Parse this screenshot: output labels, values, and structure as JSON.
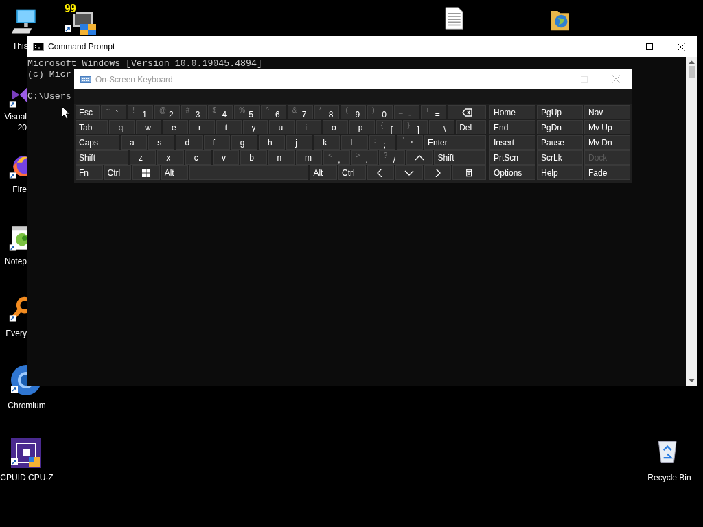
{
  "desktop_icons": [
    {
      "kind": "computer",
      "lines": [
        "This"
      ]
    },
    {
      "kind": "monitor-shield",
      "badge": "99"
    },
    {
      "kind": "document"
    },
    {
      "kind": "folder-globe"
    },
    {
      "kind": "visual-studio",
      "lines": [
        "Visual",
        "20"
      ]
    },
    {
      "kind": "firefox",
      "lines": [
        "Fire"
      ]
    },
    {
      "kind": "notepad",
      "lines": [
        "Notep"
      ]
    },
    {
      "kind": "everything",
      "lines": [
        "Every"
      ]
    },
    {
      "kind": "chromium",
      "lines": [
        "Chromium"
      ]
    },
    {
      "kind": "cpu",
      "lines": [
        "CPUID CPU-Z"
      ]
    },
    {
      "kind": "recycle",
      "lines": [
        "Recycle Bin"
      ]
    }
  ],
  "command_prompt": {
    "title": "Command Prompt",
    "lines": [
      {
        "text": "Microsoft Windows [Version 10.0.19045.4894]",
        "blank_before": false
      },
      {
        "text": "(c) Micr",
        "blank_before": false
      },
      {
        "text": "C:\\Users",
        "blank_before": true
      }
    ]
  },
  "on_screen_keyboard": {
    "title": "On-Screen Keyboard",
    "rows": [
      [
        {
          "kind": "label",
          "main": "Esc"
        },
        {
          "kind": "char",
          "top": "~",
          "main": "`"
        },
        {
          "kind": "char",
          "top": "!",
          "main": "1"
        },
        {
          "kind": "char",
          "top": "@",
          "main": "2"
        },
        {
          "kind": "char",
          "top": "#",
          "main": "3"
        },
        {
          "kind": "char",
          "top": "$",
          "main": "4"
        },
        {
          "kind": "char",
          "top": "%",
          "main": "5"
        },
        {
          "kind": "char",
          "top": "^",
          "main": "6"
        },
        {
          "kind": "char",
          "top": "&",
          "main": "7"
        },
        {
          "kind": "char",
          "top": "*",
          "main": "8"
        },
        {
          "kind": "char",
          "top": "(",
          "main": "9"
        },
        {
          "kind": "char",
          "top": ")",
          "main": "0"
        },
        {
          "kind": "char",
          "top": "_",
          "main": "-"
        },
        {
          "kind": "char",
          "top": "+",
          "main": "="
        },
        {
          "kind": "backspace"
        }
      ],
      [
        {
          "kind": "label",
          "main": "Tab"
        },
        {
          "kind": "char",
          "main": "q"
        },
        {
          "kind": "char",
          "main": "w"
        },
        {
          "kind": "char",
          "main": "e"
        },
        {
          "kind": "char",
          "main": "r"
        },
        {
          "kind": "char",
          "main": "t"
        },
        {
          "kind": "char",
          "main": "y"
        },
        {
          "kind": "char",
          "main": "u"
        },
        {
          "kind": "char",
          "main": "i"
        },
        {
          "kind": "char",
          "main": "o"
        },
        {
          "kind": "char",
          "main": "p"
        },
        {
          "kind": "char",
          "top": "{",
          "main": "["
        },
        {
          "kind": "char",
          "top": "}",
          "main": "]"
        },
        {
          "kind": "char",
          "top": "|",
          "main": "\\"
        },
        {
          "kind": "label",
          "main": "Del"
        }
      ],
      [
        {
          "kind": "label",
          "main": "Caps"
        },
        {
          "kind": "char",
          "main": "a"
        },
        {
          "kind": "char",
          "main": "s"
        },
        {
          "kind": "char",
          "main": "d"
        },
        {
          "kind": "char",
          "main": "f"
        },
        {
          "kind": "char",
          "main": "g"
        },
        {
          "kind": "char",
          "main": "h"
        },
        {
          "kind": "char",
          "main": "j"
        },
        {
          "kind": "char",
          "main": "k"
        },
        {
          "kind": "char",
          "main": "l"
        },
        {
          "kind": "char",
          "top": ":",
          "main": ";"
        },
        {
          "kind": "char",
          "top": "\"",
          "main": "'"
        },
        {
          "kind": "label",
          "main": "Enter"
        }
      ],
      [
        {
          "kind": "label",
          "main": "Shift"
        },
        {
          "kind": "char",
          "main": "z"
        },
        {
          "kind": "char",
          "main": "x"
        },
        {
          "kind": "char",
          "main": "c"
        },
        {
          "kind": "char",
          "main": "v"
        },
        {
          "kind": "char",
          "main": "b"
        },
        {
          "kind": "char",
          "main": "n"
        },
        {
          "kind": "char",
          "main": "m"
        },
        {
          "kind": "char",
          "top": "<",
          "main": ","
        },
        {
          "kind": "char",
          "top": ">",
          "main": "."
        },
        {
          "kind": "char",
          "top": "?",
          "main": "/"
        },
        {
          "kind": "up"
        },
        {
          "kind": "label",
          "main": "Shift"
        }
      ],
      [
        {
          "kind": "label",
          "main": "Fn"
        },
        {
          "kind": "label",
          "main": "Ctrl"
        },
        {
          "kind": "windows"
        },
        {
          "kind": "label",
          "main": "Alt"
        },
        {
          "kind": "space"
        },
        {
          "kind": "label",
          "main": "Alt"
        },
        {
          "kind": "label",
          "main": "Ctrl"
        },
        {
          "kind": "left"
        },
        {
          "kind": "down"
        },
        {
          "kind": "right"
        },
        {
          "kind": "menu"
        }
      ]
    ],
    "side_keys": [
      {
        "label": "Home",
        "disabled": false
      },
      {
        "label": "PgUp",
        "disabled": false
      },
      {
        "label": "Nav",
        "disabled": false
      },
      {
        "label": "End",
        "disabled": false
      },
      {
        "label": "PgDn",
        "disabled": false
      },
      {
        "label": "Mv Up",
        "disabled": false
      },
      {
        "label": "Insert",
        "disabled": false
      },
      {
        "label": "Pause",
        "disabled": false
      },
      {
        "label": "Mv Dn",
        "disabled": false
      },
      {
        "label": "PrtScn",
        "disabled": false
      },
      {
        "label": "ScrLk",
        "disabled": false
      },
      {
        "label": "Dock",
        "disabled": true
      },
      {
        "label": "Options",
        "disabled": false
      },
      {
        "label": "Help",
        "disabled": false
      },
      {
        "label": "Fade",
        "disabled": false
      }
    ]
  }
}
